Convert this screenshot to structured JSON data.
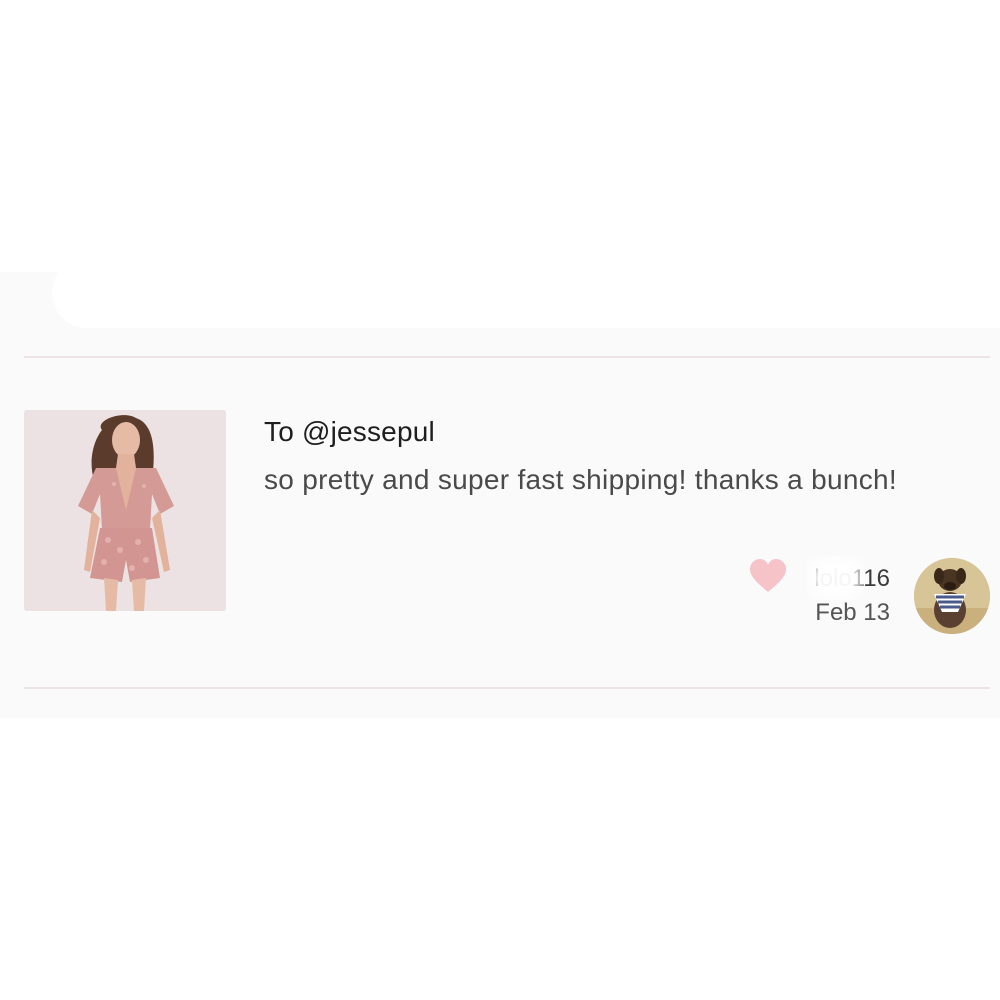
{
  "review": {
    "recipient": "To @jessepul",
    "comment": "so pretty and super fast shipping! thanks a bunch!",
    "username": "lolo116",
    "date": "Feb 13"
  },
  "icons": {
    "like": "heart-icon",
    "product": "product-photo",
    "reviewer": "avatar"
  },
  "colors": {
    "heart": "#f6c3c9",
    "divider": "#ebe3e4",
    "background": "#fbfafa"
  }
}
